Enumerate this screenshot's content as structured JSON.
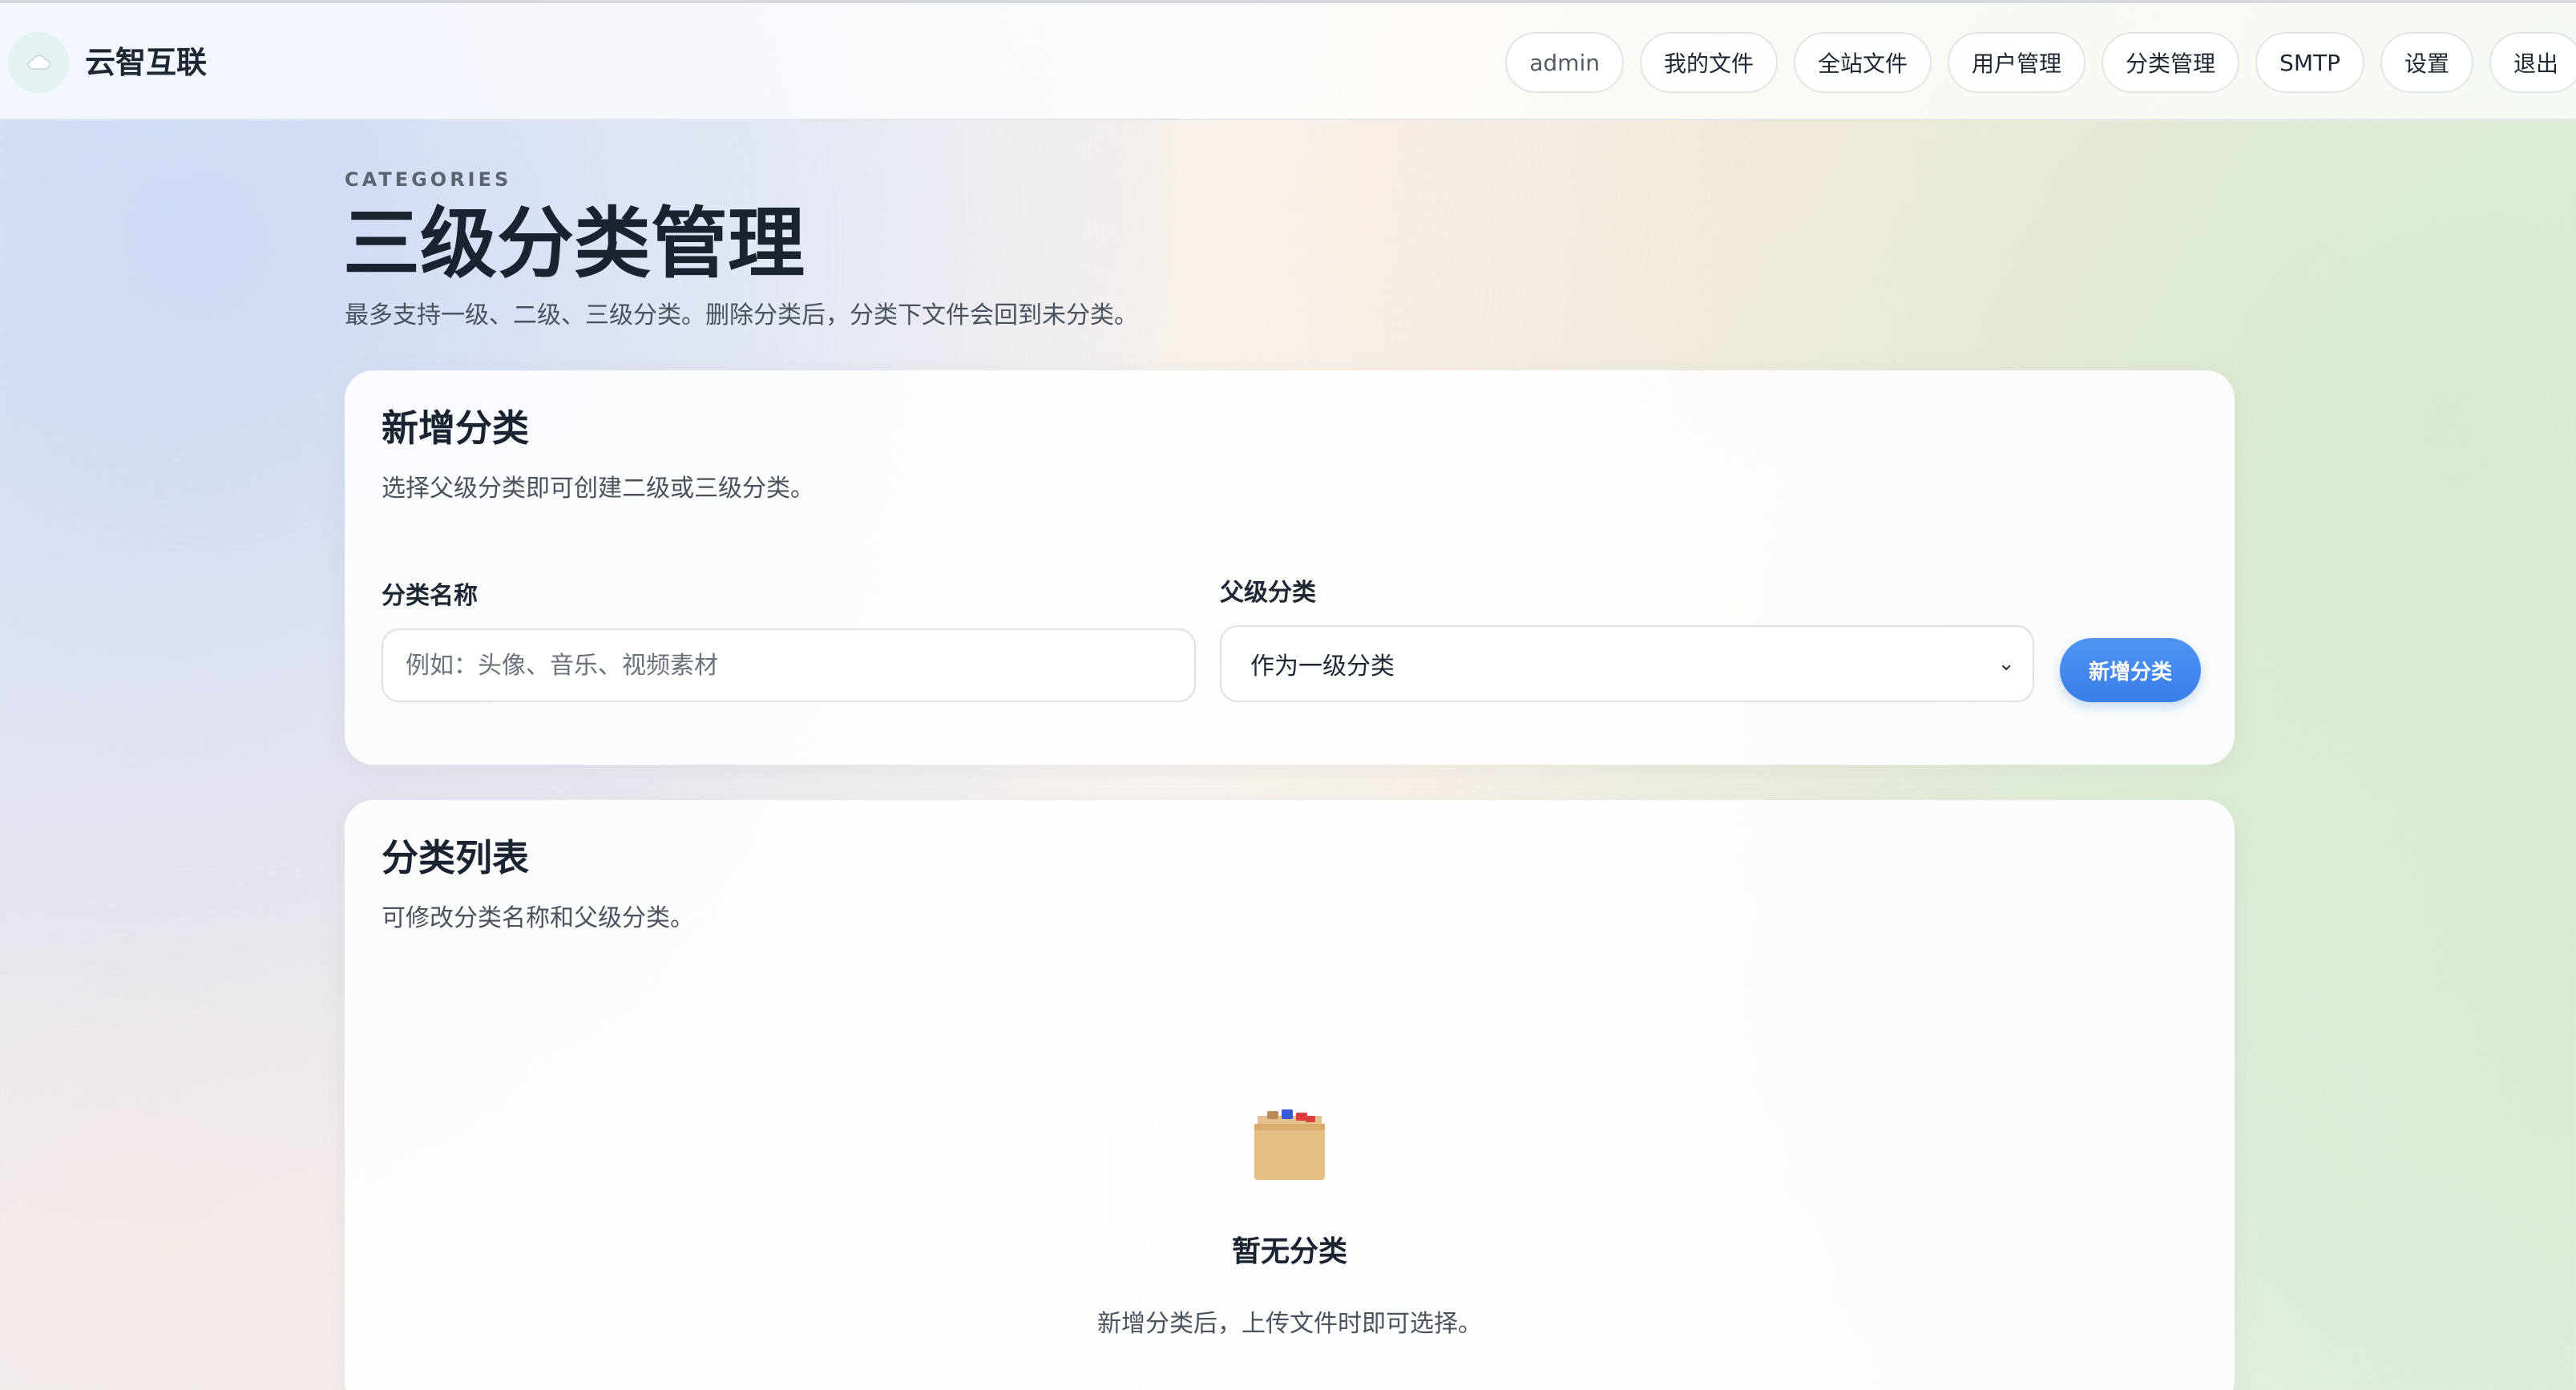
{
  "header": {
    "brand": "云智互联",
    "nav": {
      "user": "admin",
      "my_files": "我的文件",
      "all_files": "全站文件",
      "user_management": "用户管理",
      "category_management": "分类管理",
      "smtp": "SMTP",
      "settings": "设置",
      "logout": "退出"
    }
  },
  "page": {
    "eyebrow": "CATEGORIES",
    "title": "三级分类管理",
    "subtitle": "最多支持一级、二级、三级分类。删除分类后，分类下文件会回到未分类。"
  },
  "add_card": {
    "title": "新增分类",
    "description": "选择父级分类即可创建二级或三级分类。",
    "name_label": "分类名称",
    "name_placeholder": "例如：头像、音乐、视频素材",
    "name_value": "",
    "parent_label": "父级分类",
    "parent_selected": "作为一级分类",
    "submit_label": "新增分类"
  },
  "list_card": {
    "title": "分类列表",
    "description": "可修改分类名称和父级分类。",
    "empty_title": "暂无分类",
    "empty_description": "新增分类后，上传文件时即可选择。"
  },
  "icons": {
    "logo": "cloud-icon",
    "empty_state": "card-index-box-icon",
    "select_arrow": "chevron-down-icon"
  },
  "colors": {
    "accent": "#3a7ee8",
    "text": "#1f2733"
  }
}
